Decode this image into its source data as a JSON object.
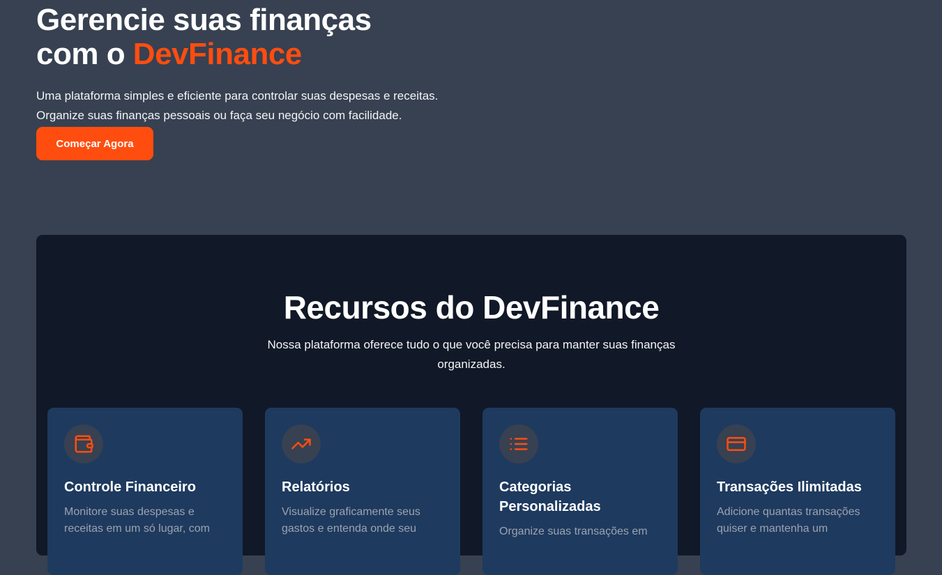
{
  "hero": {
    "title_line1": "Gerencie suas finanças",
    "title_line2_prefix": "com o ",
    "title_brand": "DevFinance",
    "description": "Uma plataforma simples e eficiente para controlar suas despesas e receitas. Organize suas finanças pessoais ou faça seu negócio com facilidade.",
    "cta_label": "Começar Agora"
  },
  "features": {
    "title": "Recursos do DevFinance",
    "subtitle": "Nossa plataforma oferece tudo o que você precisa para manter suas finanças organizadas.",
    "cards": [
      {
        "icon": "wallet-icon",
        "title": "Controle Financeiro",
        "description": "Monitore suas despesas e receitas em um só lugar, com"
      },
      {
        "icon": "trending-up-icon",
        "title": "Relatórios",
        "description": "Visualize graficamente seus gastos e entenda onde seu"
      },
      {
        "icon": "list-icon",
        "title": "Categorias Personalizadas",
        "description": "Organize suas transações em"
      },
      {
        "icon": "credit-card-icon",
        "title": "Transações Ilimitadas",
        "description": "Adicione quantas transações quiser e mantenha um"
      }
    ]
  },
  "colors": {
    "background": "#374151",
    "accent": "#ff4d0f",
    "section_bg": "#111827",
    "card_bg": "#1e3a5f",
    "muted_text": "#9ca3af"
  }
}
